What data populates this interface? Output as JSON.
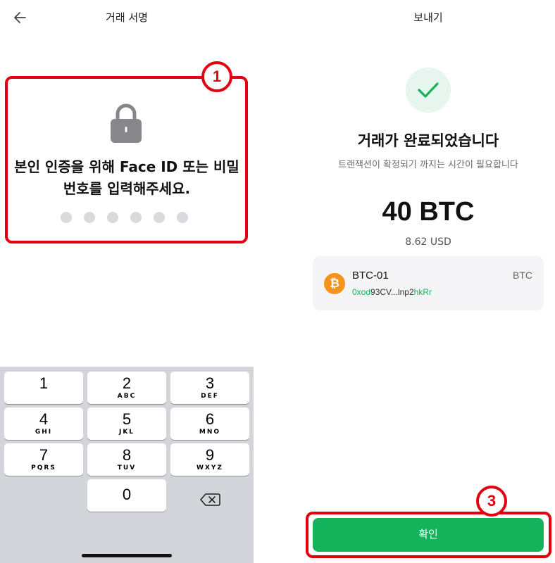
{
  "left_screen": {
    "title": "거래 서명",
    "back_icon": "arrow-left-icon",
    "lock_icon": "lock-icon",
    "auth_message_line1": "본인 인증을 위해 Face ID 또는 비밀",
    "auth_message_line2": "번호를 입력해주세요.",
    "passcode_length": 6,
    "step_badge": "1",
    "keypad": [
      {
        "num": "1",
        "letters": ""
      },
      {
        "num": "2",
        "letters": "ABC"
      },
      {
        "num": "3",
        "letters": "DEF"
      },
      {
        "num": "4",
        "letters": "GHI"
      },
      {
        "num": "5",
        "letters": "JKL"
      },
      {
        "num": "6",
        "letters": "MNO"
      },
      {
        "num": "7",
        "letters": "PQRS"
      },
      {
        "num": "8",
        "letters": "TUV"
      },
      {
        "num": "9",
        "letters": "WXYZ"
      },
      {
        "num": "0",
        "letters": ""
      }
    ],
    "delete_icon": "backspace-icon"
  },
  "right_screen": {
    "title": "보내기",
    "check_icon": "checkmark-icon",
    "done_title": "거래가 완료되었습니다",
    "done_subtitle": "트랜잭션이 확정되기 까지는 시간이 필요합니다",
    "amount": "40 BTC",
    "usd_value": "8.62 USD",
    "wallet": {
      "icon": "bitcoin-icon",
      "icon_glyph": "₿",
      "name": "BTC-01",
      "ticker": "BTC",
      "address_prefix": "0xod",
      "address_middle": "93CV...lnp2",
      "address_suffix": "hkRr"
    },
    "confirm_label": "확인",
    "step_badge": "3"
  },
  "colors": {
    "highlight_red": "#e3000f",
    "brand_green": "#14b25a",
    "bitcoin_orange": "#f7931a"
  }
}
